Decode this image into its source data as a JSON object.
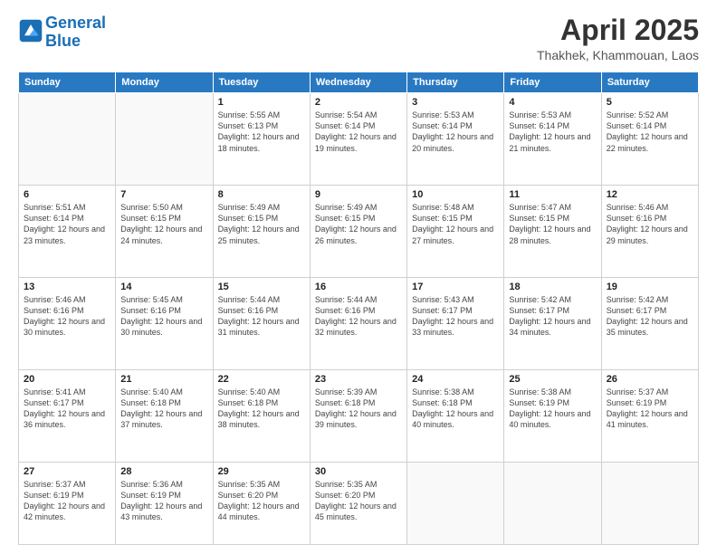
{
  "header": {
    "logo_line1": "General",
    "logo_line2": "Blue",
    "title": "April 2025",
    "location": "Thakhek, Khammouan, Laos"
  },
  "weekdays": [
    "Sunday",
    "Monday",
    "Tuesday",
    "Wednesday",
    "Thursday",
    "Friday",
    "Saturday"
  ],
  "weeks": [
    [
      {
        "day": "",
        "info": ""
      },
      {
        "day": "",
        "info": ""
      },
      {
        "day": "1",
        "info": "Sunrise: 5:55 AM\nSunset: 6:13 PM\nDaylight: 12 hours\nand 18 minutes."
      },
      {
        "day": "2",
        "info": "Sunrise: 5:54 AM\nSunset: 6:14 PM\nDaylight: 12 hours\nand 19 minutes."
      },
      {
        "day": "3",
        "info": "Sunrise: 5:53 AM\nSunset: 6:14 PM\nDaylight: 12 hours\nand 20 minutes."
      },
      {
        "day": "4",
        "info": "Sunrise: 5:53 AM\nSunset: 6:14 PM\nDaylight: 12 hours\nand 21 minutes."
      },
      {
        "day": "5",
        "info": "Sunrise: 5:52 AM\nSunset: 6:14 PM\nDaylight: 12 hours\nand 22 minutes."
      }
    ],
    [
      {
        "day": "6",
        "info": "Sunrise: 5:51 AM\nSunset: 6:14 PM\nDaylight: 12 hours\nand 23 minutes."
      },
      {
        "day": "7",
        "info": "Sunrise: 5:50 AM\nSunset: 6:15 PM\nDaylight: 12 hours\nand 24 minutes."
      },
      {
        "day": "8",
        "info": "Sunrise: 5:49 AM\nSunset: 6:15 PM\nDaylight: 12 hours\nand 25 minutes."
      },
      {
        "day": "9",
        "info": "Sunrise: 5:49 AM\nSunset: 6:15 PM\nDaylight: 12 hours\nand 26 minutes."
      },
      {
        "day": "10",
        "info": "Sunrise: 5:48 AM\nSunset: 6:15 PM\nDaylight: 12 hours\nand 27 minutes."
      },
      {
        "day": "11",
        "info": "Sunrise: 5:47 AM\nSunset: 6:15 PM\nDaylight: 12 hours\nand 28 minutes."
      },
      {
        "day": "12",
        "info": "Sunrise: 5:46 AM\nSunset: 6:16 PM\nDaylight: 12 hours\nand 29 minutes."
      }
    ],
    [
      {
        "day": "13",
        "info": "Sunrise: 5:46 AM\nSunset: 6:16 PM\nDaylight: 12 hours\nand 30 minutes."
      },
      {
        "day": "14",
        "info": "Sunrise: 5:45 AM\nSunset: 6:16 PM\nDaylight: 12 hours\nand 30 minutes."
      },
      {
        "day": "15",
        "info": "Sunrise: 5:44 AM\nSunset: 6:16 PM\nDaylight: 12 hours\nand 31 minutes."
      },
      {
        "day": "16",
        "info": "Sunrise: 5:44 AM\nSunset: 6:16 PM\nDaylight: 12 hours\nand 32 minutes."
      },
      {
        "day": "17",
        "info": "Sunrise: 5:43 AM\nSunset: 6:17 PM\nDaylight: 12 hours\nand 33 minutes."
      },
      {
        "day": "18",
        "info": "Sunrise: 5:42 AM\nSunset: 6:17 PM\nDaylight: 12 hours\nand 34 minutes."
      },
      {
        "day": "19",
        "info": "Sunrise: 5:42 AM\nSunset: 6:17 PM\nDaylight: 12 hours\nand 35 minutes."
      }
    ],
    [
      {
        "day": "20",
        "info": "Sunrise: 5:41 AM\nSunset: 6:17 PM\nDaylight: 12 hours\nand 36 minutes."
      },
      {
        "day": "21",
        "info": "Sunrise: 5:40 AM\nSunset: 6:18 PM\nDaylight: 12 hours\nand 37 minutes."
      },
      {
        "day": "22",
        "info": "Sunrise: 5:40 AM\nSunset: 6:18 PM\nDaylight: 12 hours\nand 38 minutes."
      },
      {
        "day": "23",
        "info": "Sunrise: 5:39 AM\nSunset: 6:18 PM\nDaylight: 12 hours\nand 39 minutes."
      },
      {
        "day": "24",
        "info": "Sunrise: 5:38 AM\nSunset: 6:18 PM\nDaylight: 12 hours\nand 40 minutes."
      },
      {
        "day": "25",
        "info": "Sunrise: 5:38 AM\nSunset: 6:19 PM\nDaylight: 12 hours\nand 40 minutes."
      },
      {
        "day": "26",
        "info": "Sunrise: 5:37 AM\nSunset: 6:19 PM\nDaylight: 12 hours\nand 41 minutes."
      }
    ],
    [
      {
        "day": "27",
        "info": "Sunrise: 5:37 AM\nSunset: 6:19 PM\nDaylight: 12 hours\nand 42 minutes."
      },
      {
        "day": "28",
        "info": "Sunrise: 5:36 AM\nSunset: 6:19 PM\nDaylight: 12 hours\nand 43 minutes."
      },
      {
        "day": "29",
        "info": "Sunrise: 5:35 AM\nSunset: 6:20 PM\nDaylight: 12 hours\nand 44 minutes."
      },
      {
        "day": "30",
        "info": "Sunrise: 5:35 AM\nSunset: 6:20 PM\nDaylight: 12 hours\nand 45 minutes."
      },
      {
        "day": "",
        "info": ""
      },
      {
        "day": "",
        "info": ""
      },
      {
        "day": "",
        "info": ""
      }
    ]
  ]
}
